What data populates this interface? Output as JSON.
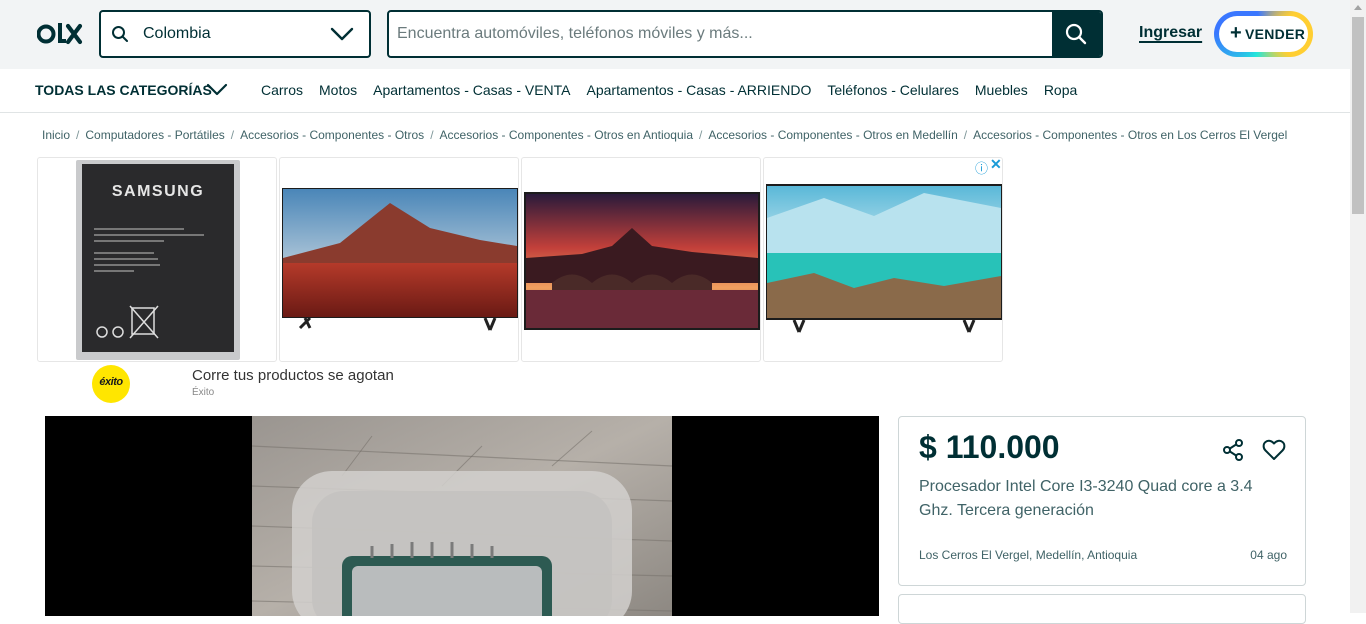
{
  "header": {
    "logo_text": "OLX",
    "location": "Colombia",
    "search_placeholder": "Encuentra automóviles, teléfonos móviles y más...",
    "login_label": "Ingresar",
    "sell_label": "VENDER",
    "sell_plus": "+"
  },
  "categories": {
    "all_label": "TODAS LAS CATEGORÍAS",
    "items": [
      "Carros",
      "Motos",
      "Apartamentos - Casas - VENTA",
      "Apartamentos - Casas - ARRIENDO",
      "Teléfonos - Celulares",
      "Muebles",
      "Ropa"
    ]
  },
  "breadcrumbs": [
    "Inicio",
    "Computadores - Portátiles",
    "Accesorios - Componentes - Otros",
    "Accesorios - Componentes - Otros en Antioquia",
    "Accesorios - Componentes - Otros en Medellín",
    "Accesorios - Componentes - Otros en Los Cerros El Vergel"
  ],
  "ad": {
    "battery_brand": "SAMSUNG",
    "logo_text": "éxito",
    "title": "Corre tus productos se agotan",
    "source": "Éxito",
    "info_icon": "ⓘ",
    "close_icon": "✕"
  },
  "listing": {
    "price": "$ 110.000",
    "title": "Procesador Intel Core I3-3240 Quad core a 3.4 Ghz. Tercera generación",
    "location": "Los Cerros El Vergel, Medellín, Antioquia",
    "date": "04 ago"
  },
  "colors": {
    "primary": "#002f34",
    "secondary_text": "#406367",
    "header_bg": "#f2f4f5",
    "ad_accent": "#1a9bd7"
  }
}
